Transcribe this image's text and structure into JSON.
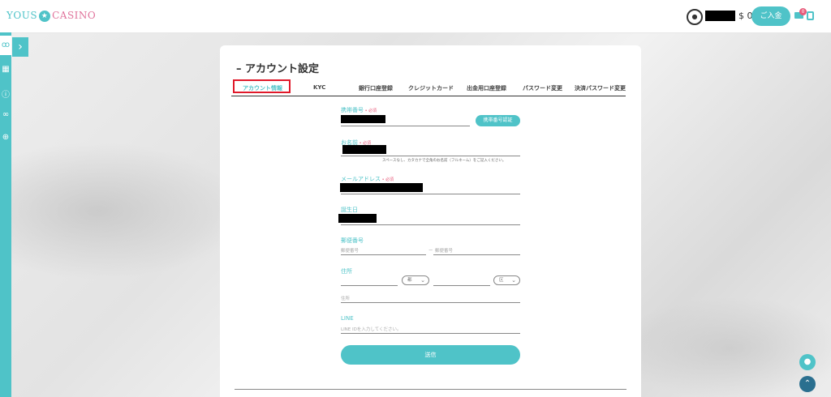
{
  "brand": {
    "part1": "YOUS",
    "star": "★",
    "part2": "CASINO",
    "primary_color": "#4fc3c8",
    "accent_color": "#e85a7a"
  },
  "header": {
    "balance": "$ 0",
    "deposit_label": "ご入金",
    "mail_badge": "0",
    "coin_icon": "coin-icon",
    "mail_icon": "mail-icon",
    "logout_icon": "logout-icon"
  },
  "sidebar": {
    "expand_icon": "chevron-right-icon",
    "items": [
      "gift-icon",
      "grid-icon",
      "info-icon",
      "link-icon",
      "globe-icon"
    ]
  },
  "page": {
    "title": "アカウント設定",
    "tabs": [
      "アカウント情報",
      "KYC",
      "銀行口座登録",
      "クレジットカード",
      "出金用口座登録",
      "パスワード変更",
      "決済パスワード変更"
    ],
    "active_tab": "アカウント情報"
  },
  "form": {
    "phone": {
      "label": "携帯番号",
      "required": "必須",
      "verify_label": "携帯番号認証"
    },
    "name": {
      "label": "お名前",
      "required": "必須",
      "note": "スペースなし、カタカナで全角のお名前（フルネーム）をご記入ください。"
    },
    "email": {
      "label": "メールアドレス",
      "required": "必須"
    },
    "birthday": {
      "label": "誕生日"
    },
    "postal": {
      "label": "郵便番号",
      "placeholder1": "郵便番号",
      "placeholder2": "郵便番号",
      "separator": "ー"
    },
    "address": {
      "label": "住所",
      "select1": "都",
      "select2": "区",
      "placeholder": "住所"
    },
    "line": {
      "label": "LINE",
      "placeholder": "LINE IDを入力してください。"
    },
    "submit_label": "送信"
  },
  "floating": {
    "chat_icon": "chat-icon",
    "top_icon": "arrow-up-icon"
  }
}
